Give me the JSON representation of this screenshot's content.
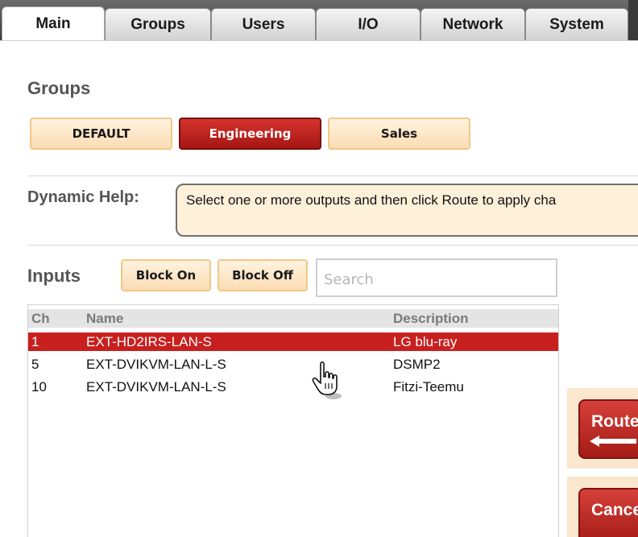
{
  "tabs": [
    {
      "label": "Main",
      "active": true
    },
    {
      "label": "Groups",
      "active": false
    },
    {
      "label": "Users",
      "active": false
    },
    {
      "label": "I/O",
      "active": false
    },
    {
      "label": "Network",
      "active": false
    },
    {
      "label": "System",
      "active": false
    }
  ],
  "groups": {
    "title": "Groups",
    "buttons": [
      {
        "label": "DEFAULT",
        "selected": false
      },
      {
        "label": "Engineering",
        "selected": true
      },
      {
        "label": "Sales",
        "selected": false
      }
    ]
  },
  "dynamic_help": {
    "label": "Dynamic Help:",
    "text": "Select one or more outputs and then click Route to apply cha"
  },
  "inputs": {
    "title": "Inputs",
    "block_on_label": "Block On",
    "block_off_label": "Block Off",
    "search_placeholder": "Search",
    "columns": [
      "Ch",
      "Name",
      "Description"
    ],
    "rows": [
      {
        "ch": "1",
        "name": "EXT-HD2IRS-LAN-S",
        "description": "LG blu-ray",
        "selected": true
      },
      {
        "ch": "5",
        "name": "EXT-DVIKVM-LAN-L-S",
        "description": "DSMP2",
        "selected": false
      },
      {
        "ch": "10",
        "name": "EXT-DVIKVM-LAN-L-S",
        "description": "Fitzi-Teemu",
        "selected": false
      }
    ]
  },
  "actions": {
    "route_label": "Route",
    "cancel_label": "Cance"
  },
  "colors": {
    "accent_red": "#c8201f",
    "button_light": "#fbdcb3",
    "help_bg": "#fff0d9"
  },
  "icons": [
    "route-arrow-icon",
    "hand-pointer-icon"
  ]
}
